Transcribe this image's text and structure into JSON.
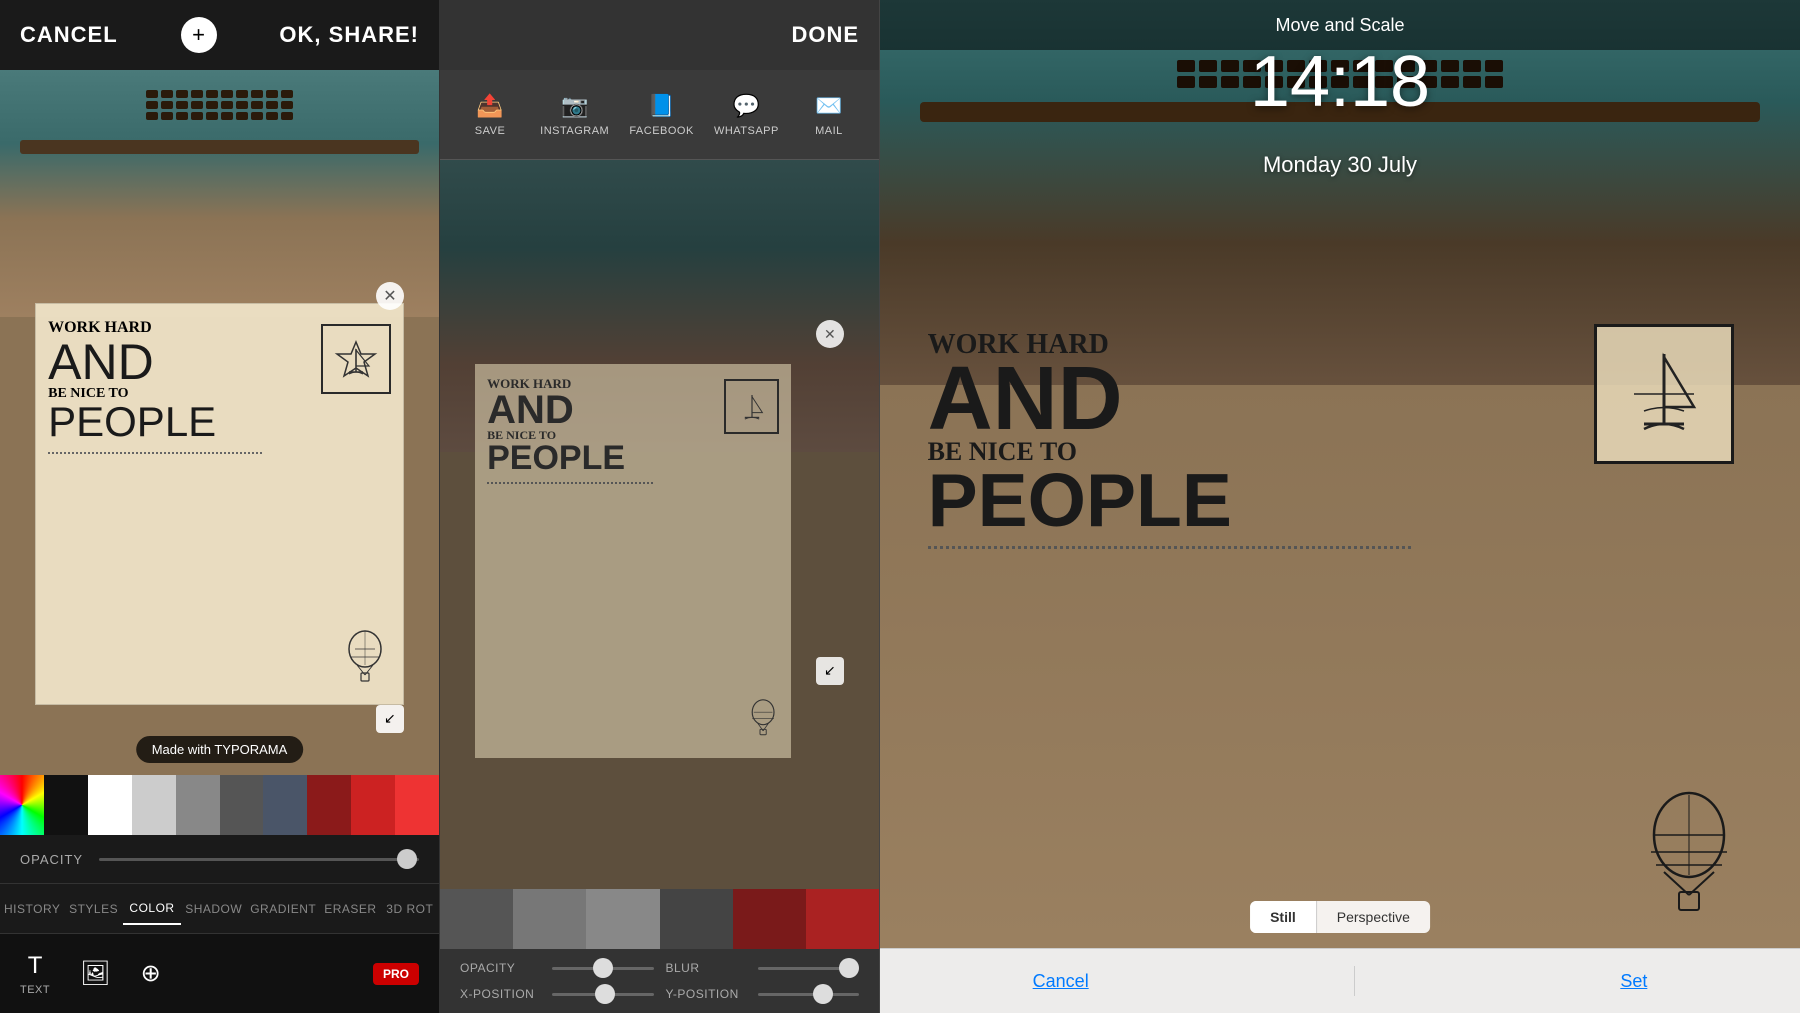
{
  "panel1": {
    "header": {
      "cancel_label": "CANCEL",
      "share_label": "OK, SHARE!"
    },
    "watermark": "Made with TYPORAMA",
    "artwork": {
      "line1": "WORK HARD",
      "line2": "AND",
      "line3": "BE NICE TO",
      "line4": "PEOPLE"
    },
    "opacity_label": "OPACITY",
    "tabs": [
      "HISTORY",
      "STYLES",
      "COLOR",
      "SHADOW",
      "GRADIENT",
      "ERASER",
      "3D ROT"
    ],
    "active_tab": "COLOR",
    "tools": {
      "text_label": "TEXT",
      "pro_label": "PRO"
    }
  },
  "panel2": {
    "header": {
      "done_label": "DONE"
    },
    "share_options": [
      {
        "icon": "📤",
        "label": "SAVE"
      },
      {
        "icon": "📷",
        "label": "INSTAGRAM"
      },
      {
        "icon": "📘",
        "label": "FACEBOOK"
      },
      {
        "icon": "💬",
        "label": "WHATSAPP"
      },
      {
        "icon": "✉️",
        "label": "MAIL"
      }
    ],
    "sliders": {
      "opacity_label": "OPACITY",
      "blur_label": "BLUR",
      "x_position_label": "X-POSITION",
      "y_position_label": "Y-POSITION"
    }
  },
  "panel3": {
    "title": "Move and Scale",
    "time": "14:18",
    "date": "Monday 30 July",
    "artwork": {
      "line1": "WORK HARD",
      "line2": "AND",
      "line3": "BE NICE TO",
      "line4": "PEOPLE"
    },
    "tabs": {
      "still_label": "Still",
      "perspective_label": "Perspective"
    },
    "cancel_label": "Cancel",
    "set_label": "Set"
  }
}
